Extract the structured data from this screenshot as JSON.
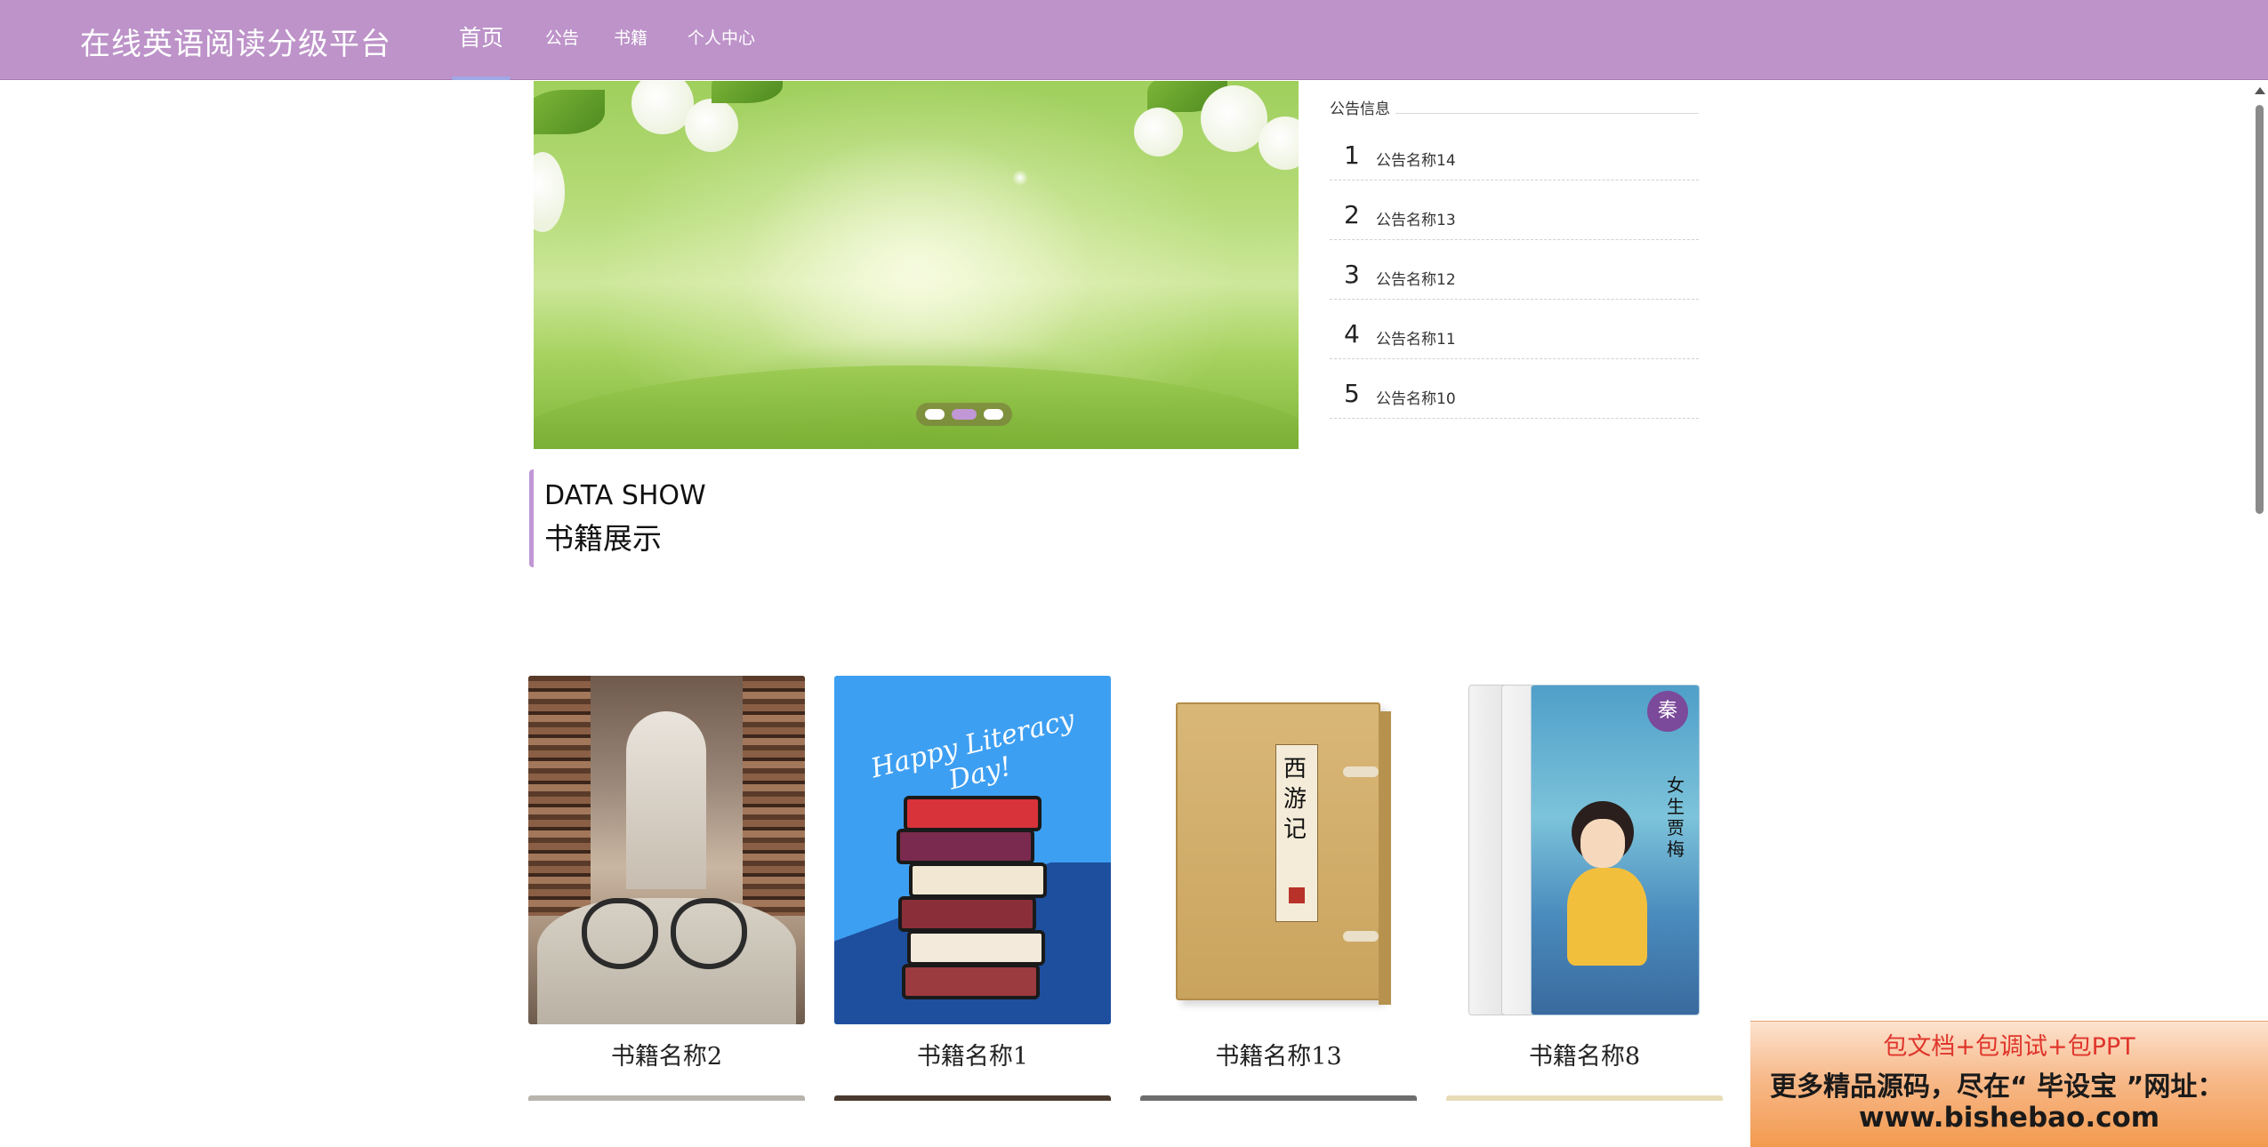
{
  "header": {
    "brand": "在线英语阅读分级平台",
    "nav": [
      {
        "label": "首页",
        "active": true
      },
      {
        "label": "公告",
        "active": false
      },
      {
        "label": "书籍",
        "active": false
      },
      {
        "label": "个人中心",
        "active": false
      }
    ]
  },
  "carousel": {
    "slides": 3,
    "active_index": 1
  },
  "notices": {
    "title": "公告信息",
    "items": [
      {
        "num": "1",
        "name": "公告名称14"
      },
      {
        "num": "2",
        "name": "公告名称13"
      },
      {
        "num": "3",
        "name": "公告名称12"
      },
      {
        "num": "4",
        "name": "公告名称11"
      },
      {
        "num": "5",
        "name": "公告名称10"
      }
    ]
  },
  "section": {
    "en": "DATA SHOW",
    "cn": "书籍展示"
  },
  "books": [
    {
      "name": "书籍名称2",
      "cover": "library-glasses"
    },
    {
      "name": "书籍名称1",
      "cover": "happy-literacy-day",
      "cover_text": "Happy Literacy Day!"
    },
    {
      "name": "书籍名称13",
      "cover": "xiyouji-box",
      "cover_text": "西游记"
    },
    {
      "name": "书籍名称8",
      "cover": "nvsheng-jiamei",
      "cover_text": "女生贾梅"
    }
  ],
  "ad": {
    "line1": "包文档+包调试+包PPT",
    "line2": "更多精品源码，尽在“ 毕设宝 ”网址：",
    "line3": "www.bishebao.com"
  },
  "colors": {
    "nav_bg": "#bd93c9",
    "accent": "#c197d6",
    "ad_red": "#e0352b"
  }
}
